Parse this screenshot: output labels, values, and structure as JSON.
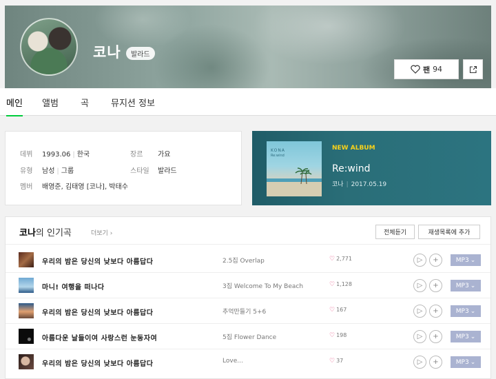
{
  "artist": {
    "name": "코나",
    "genre_badge": "발라드",
    "fan_label": "팬",
    "fan_count": "94"
  },
  "tabs": [
    {
      "label": "메인",
      "active": true
    },
    {
      "label": "앨범",
      "active": false
    },
    {
      "label": "곡",
      "active": false
    },
    {
      "label": "뮤지션 정보",
      "active": false
    }
  ],
  "info": {
    "debut_key": "데뷔",
    "debut_val": "1993.06",
    "debut_country": "한국",
    "genre_key": "장르",
    "genre_val": "가요",
    "type_key": "유형",
    "type_val": "남성",
    "type_val2": "그룹",
    "style_key": "스타일",
    "style_val": "발라드",
    "member_key": "멤버",
    "member_val": "배영준, 김태영 [코나], 박태수"
  },
  "new_album": {
    "tag": "NEW ALBUM",
    "title": "Re:wind",
    "artist": "코나",
    "date": "2017.05.19",
    "cover_text": "KONA",
    "cover_sub": "Re:wind"
  },
  "popular": {
    "title_artist": "코나",
    "title_suffix": "의 인기곡",
    "more": "더보기 ›",
    "play_all": "전체듣기",
    "add_playlist": "재생목록에 추가",
    "mp3_label": "MP3",
    "rows": [
      {
        "song": "우리의 밤은 당신의 낮보다 아름답다",
        "album": "2.5집 Overlap",
        "likes": "2,771"
      },
      {
        "song": "마니! 여행을 떠나다",
        "album": "3집 Welcome To My Beach",
        "likes": "1,128"
      },
      {
        "song": "우리의 밤은 당신의 낮보다 아름답다",
        "album": "추억만들기 5+6",
        "likes": "167"
      },
      {
        "song": "아름다운 날들이여 사랑스런 눈동자여",
        "album": "5집 Flower Dance",
        "likes": "198"
      },
      {
        "song": "우리의 밤은 당신의 낮보다 아름답다",
        "album": "Love...",
        "likes": "37"
      }
    ]
  },
  "colors": {
    "accent": "#00cd3c",
    "new_album_tag": "#f9d21a",
    "mp3_button": "#aab3d1",
    "like_heart": "#e0306a",
    "album_card_bg": "#2a6e78"
  }
}
